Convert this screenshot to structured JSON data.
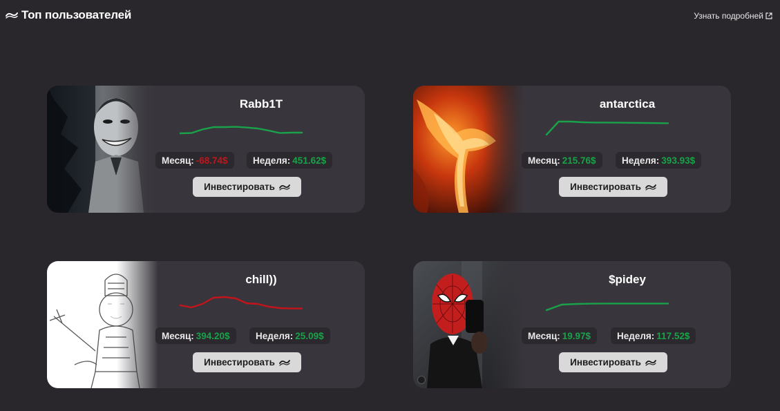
{
  "header": {
    "title": "Топ пользователей",
    "learn_more": "Узнать подробней",
    "icon": "logo-wave-icon"
  },
  "colors": {
    "positive": "#19a24a",
    "negative": "#c4141b",
    "card_bg": "#38363c",
    "page_bg": "#29272c"
  },
  "labels": {
    "month": "Месяц:",
    "week": "Неделя:",
    "invest": "Инвестировать"
  },
  "cards": [
    {
      "name": "Rabb1T",
      "month": "-68.74$",
      "week": "451.62$",
      "trend": "up",
      "avatar": "joker-dark-artwork",
      "spark_series": [
        0.1,
        0.12,
        0.38,
        0.55,
        0.55,
        0.57,
        0.52,
        0.45,
        0.3,
        0.12,
        0.15,
        0.15
      ]
    },
    {
      "name": "antarctica",
      "month": "215.76$",
      "week": "393.93$",
      "trend": "up",
      "avatar": "fire-phoenix-artwork",
      "spark_series": [
        0.0,
        0.95,
        0.95,
        0.9,
        0.88,
        0.88,
        0.87,
        0.86,
        0.85,
        0.84,
        0.83
      ]
    },
    {
      "name": "chill))",
      "month": "394.20$",
      "week": "25.09$",
      "trend": "down",
      "avatar": "knight-pencil-sketch",
      "spark_series": [
        0.35,
        0.2,
        0.45,
        0.9,
        0.95,
        0.85,
        0.5,
        0.45,
        0.25,
        0.15,
        0.12,
        0.12
      ]
    },
    {
      "name": "$pidey",
      "month": "19.97$",
      "week": "117.52$",
      "trend": "up",
      "avatar": "spiderman-mask-photo",
      "spark_series": [
        0.0,
        0.4,
        0.45,
        0.47,
        0.48,
        0.48,
        0.48,
        0.48,
        0.48
      ]
    }
  ]
}
